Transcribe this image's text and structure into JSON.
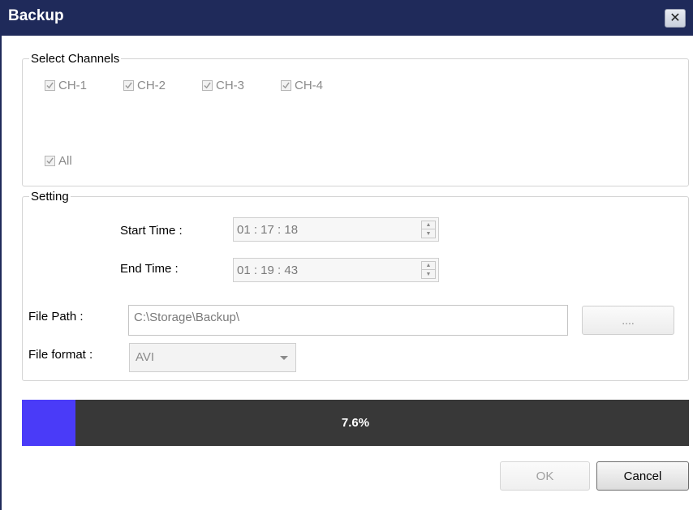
{
  "window": {
    "title": "Backup",
    "close_glyph": "✕",
    "close_icon": "close-icon"
  },
  "channels": {
    "legend": "Select Channels",
    "items": [
      {
        "label": "CH-1",
        "checked": true
      },
      {
        "label": "CH-2",
        "checked": true
      },
      {
        "label": "CH-3",
        "checked": true
      },
      {
        "label": "CH-4",
        "checked": true
      }
    ],
    "all_label": "All",
    "all_checked": true
  },
  "setting": {
    "legend": "Setting",
    "start_time_label": "Start Time :",
    "start_time_value": "01 : 17 : 18",
    "end_time_label": "End Time :",
    "end_time_value": "01 : 19 : 43",
    "file_path_label": "File Path :",
    "file_path_value": "C:\\Storage\\Backup\\",
    "browse_label": "....",
    "file_format_label": "File format :",
    "file_format_value": "AVI"
  },
  "progress": {
    "percent_text": "7.6%",
    "fraction": 0.08,
    "fill_color": "#4a3bf8",
    "track_color": "#383838"
  },
  "buttons": {
    "ok": "OK",
    "cancel": "Cancel"
  },
  "colors": {
    "titlebar": "#1f2a5a"
  }
}
